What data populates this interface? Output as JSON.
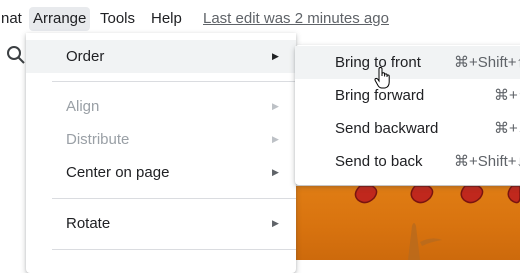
{
  "menubar": {
    "items": [
      {
        "label": "nat"
      },
      {
        "label": "Arrange"
      },
      {
        "label": "Tools"
      },
      {
        "label": "Help"
      }
    ],
    "last_edit": "Last edit was 2 minutes ago"
  },
  "toolbar": {
    "icon": "search-icon"
  },
  "arrange_menu": {
    "items": [
      {
        "label": "Order",
        "has_submenu": true,
        "disabled": false
      },
      {
        "label": "Align",
        "has_submenu": true,
        "disabled": true
      },
      {
        "label": "Distribute",
        "has_submenu": true,
        "disabled": true
      },
      {
        "label": "Center on page",
        "has_submenu": true,
        "disabled": false
      },
      {
        "label": "Rotate",
        "has_submenu": true,
        "disabled": false
      }
    ]
  },
  "order_submenu": {
    "items": [
      {
        "label": "Bring to front",
        "shortcut": "⌘+Shift+↑"
      },
      {
        "label": "Bring forward",
        "shortcut": "⌘+↑"
      },
      {
        "label": "Send backward",
        "shortcut": "⌘+↓"
      },
      {
        "label": "Send to back",
        "shortcut": "⌘+Shift+↓"
      }
    ]
  },
  "colors": {
    "menu_hover": "#f1f3f4",
    "menubar_active": "#e8eaed",
    "canvas_orange": "#e07d14",
    "flower_red": "#c0281d"
  }
}
